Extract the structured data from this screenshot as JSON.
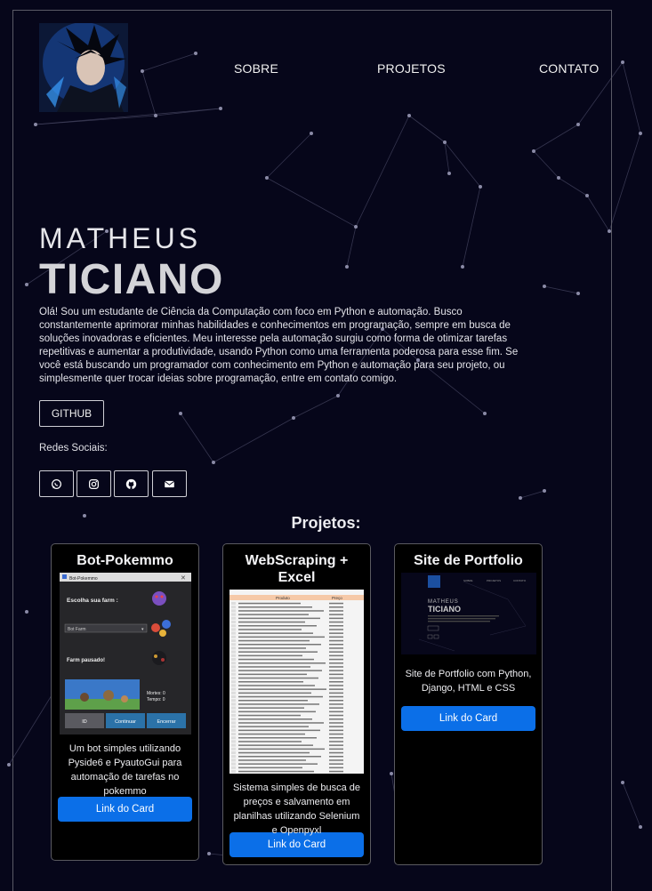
{
  "nav": {
    "sobre": "SOBRE",
    "projetos": "PROJETOS",
    "contato": "CONTATO"
  },
  "hero": {
    "first_name": "MATHEUS",
    "last_name": "TICIANO",
    "bio": "Olá! Sou um estudante de Ciência da Computação com foco em Python e automação. Busco constantemente aprimorar minhas habilidades e conhecimentos em programação, sempre em busca de soluções inovadoras e eficientes. Meu interesse pela automação surgiu como forma de otimizar tarefas repetitivas e aumentar a produtividade, usando Python como uma ferramenta poderosa para esse fim. Se você está buscando um programador com conhecimento em Python e automação para seu projeto, ou simplesmente quer trocar ideias sobre programação, entre em contato comigo.",
    "github_label": "GITHUB",
    "redes_label": "Redes Sociais:",
    "social_icons": [
      "whatsapp-icon",
      "instagram-icon",
      "github-icon",
      "mail-icon"
    ]
  },
  "projects": {
    "title": "Projetos:",
    "cards": [
      {
        "title": "Bot-Pokemmo",
        "description": "Um bot simples utilizando Pyside6 e PyautoGui para automação de tarefas no pokemmo",
        "link": "Link do Card",
        "screenshot": {
          "window_title": "Bot-Pokemmo",
          "farm_label": "Escolha sua farm :",
          "select_value": "Bot Farm",
          "status": "Farm pausado!",
          "stats1": "Mortes: 0",
          "stats2": "Tempo: 0",
          "btn_id": "ID",
          "btn_continuar": "Continuar",
          "btn_encerrar": "Encerrar"
        }
      },
      {
        "title": "WebScraping + Excel",
        "description": "Sistema simples de busca de preços e salvamento em planilhas utilizando Selenium e Openpyxl",
        "link": "Link do Card",
        "screenshot": {
          "col_a": "Produto",
          "col_b": "Preço"
        }
      },
      {
        "title": "Site de Portfolio",
        "description": "Site de Portfolio com Python, Django, HTML e CSS",
        "link": "Link do Card",
        "screenshot": {
          "name1": "MATHEUS",
          "name2": "TICIANO"
        }
      }
    ]
  },
  "colors": {
    "background": "#06061a",
    "accent": "#0b6fe8",
    "frame_border": "#5a5a66"
  }
}
